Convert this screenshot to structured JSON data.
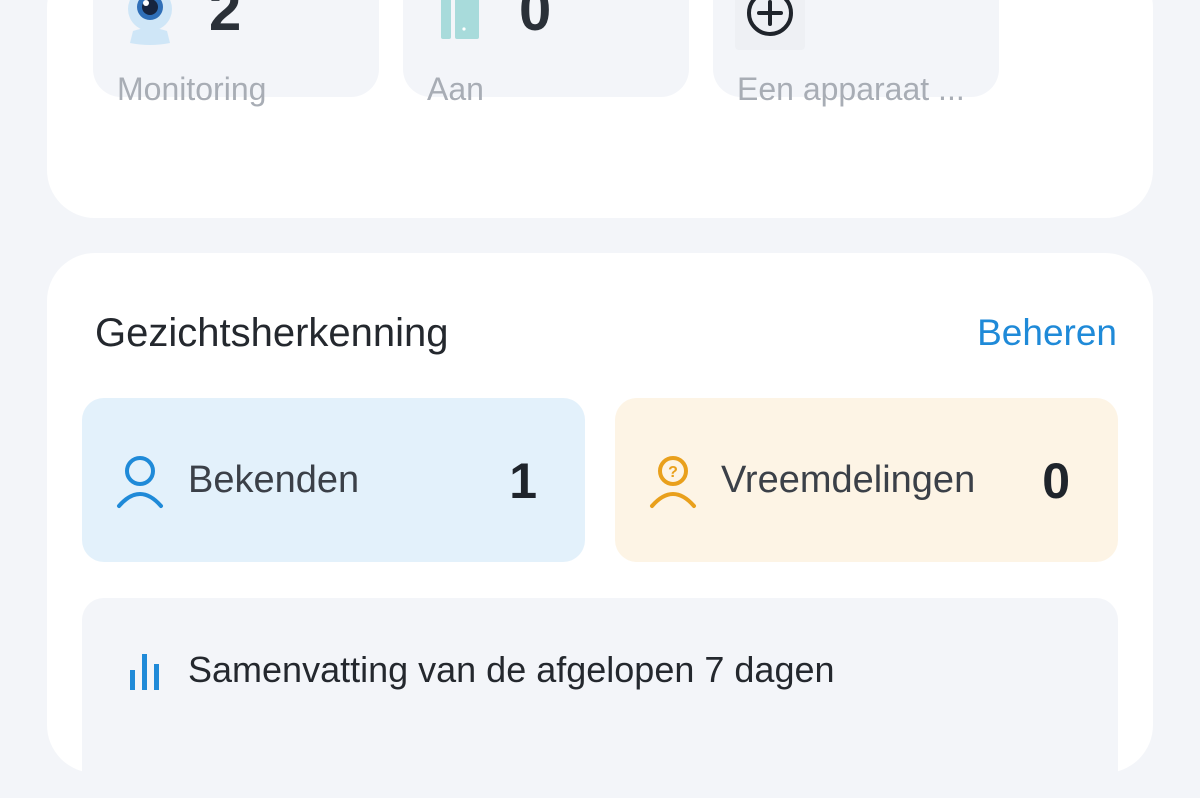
{
  "devices": {
    "tiles": [
      {
        "count": "2",
        "label": "Monitoring",
        "icon": "camera-icon"
      },
      {
        "count": "0",
        "label": "Aan",
        "icon": "door-icon"
      },
      {
        "count": "",
        "label": "Een apparaat ...",
        "icon": "add-circle-icon"
      }
    ]
  },
  "face_recognition": {
    "title": "Gezichtsherkenning",
    "manage_label": "Beheren",
    "known": {
      "label": "Bekenden",
      "count": "1",
      "color": "#1f8ad8"
    },
    "strangers": {
      "label": "Vreemdelingen",
      "count": "0",
      "color": "#e9a01c"
    },
    "summary": {
      "label": "Samenvatting van de afgelopen 7 dagen",
      "icon": "bar-chart-icon"
    }
  },
  "colors": {
    "accent": "#1f8ad8",
    "page_bg": "#f3f5f9",
    "card_bg": "#ffffff",
    "known_bg": "#e3f1fb",
    "stranger_bg": "#fdf4e5"
  }
}
